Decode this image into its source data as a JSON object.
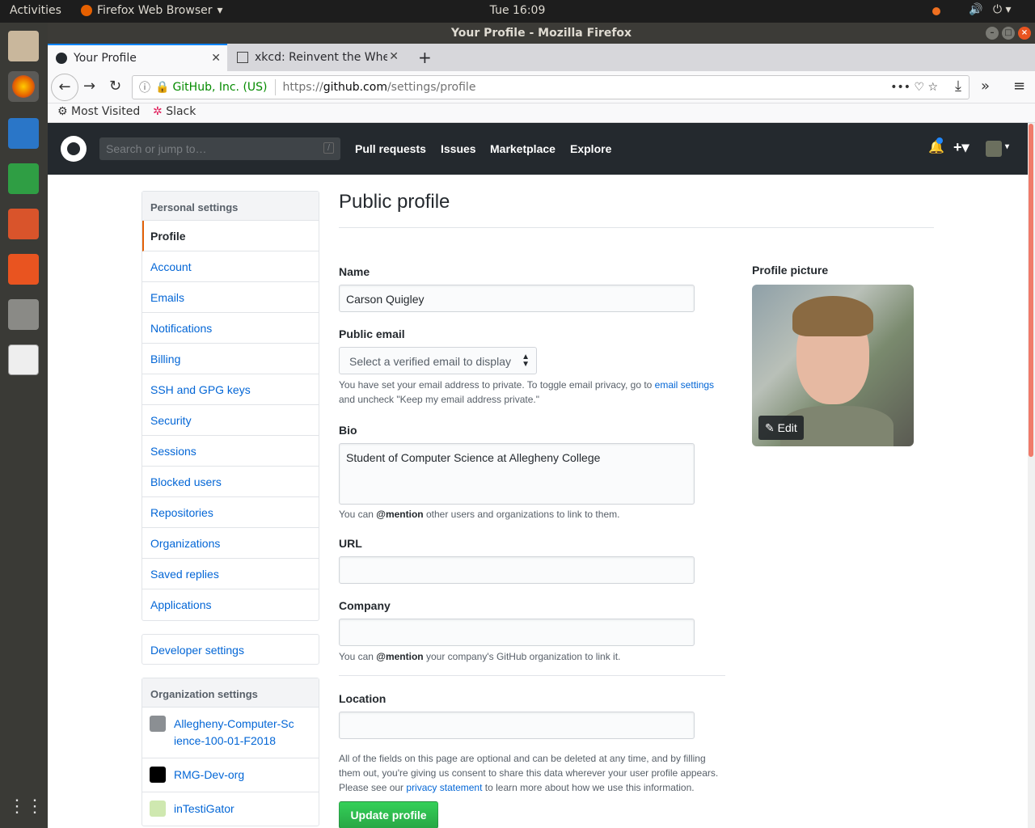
{
  "topbar": {
    "activities": "Activities",
    "app": "Firefox Web Browser",
    "clock": "Tue 16:09"
  },
  "window": {
    "title": "Your Profile - Mozilla Firefox"
  },
  "tabs": [
    {
      "label": "Your Profile"
    },
    {
      "label": "xkcd: Reinvent the Whee"
    }
  ],
  "navbar": {
    "identity": "GitHub, Inc. (US)",
    "url_prefix": "https://",
    "url_host": "github.com",
    "url_path": "/settings/profile"
  },
  "bookmarks": [
    {
      "label": "Most Visited"
    },
    {
      "label": "Slack"
    }
  ],
  "github": {
    "search_placeholder": "Search or jump to…",
    "search_key": "/",
    "nav": [
      "Pull requests",
      "Issues",
      "Marketplace",
      "Explore"
    ]
  },
  "sidebar": {
    "header": "Personal settings",
    "items": [
      "Profile",
      "Account",
      "Emails",
      "Notifications",
      "Billing",
      "SSH and GPG keys",
      "Security",
      "Sessions",
      "Blocked users",
      "Repositories",
      "Organizations",
      "Saved replies",
      "Applications"
    ],
    "developer": "Developer settings",
    "org_header": "Organization settings",
    "orgs": [
      "Allegheny-Computer-Science-100-01-F2018",
      "RMG-Dev-org",
      "inTestiGator"
    ]
  },
  "profile": {
    "title": "Public profile",
    "name_label": "Name",
    "name_value": "Carson Quigley",
    "email_label": "Public email",
    "email_select": "Select a verified email to display",
    "email_note_1": "You have set your email address to private. To toggle email privacy, go to ",
    "email_note_link": "email settings",
    "email_note_2": "and uncheck \"Keep my email address private.\"",
    "bio_label": "Bio",
    "bio_value": "Student of Computer Science at Allegheny College",
    "bio_note_1": "You can ",
    "bio_note_mention": "@mention",
    "bio_note_2": " other users and organizations to link to them.",
    "url_label": "URL",
    "company_label": "Company",
    "company_note_1": "You can ",
    "company_note_mention": "@mention",
    "company_note_2": " your company's GitHub organization to link it.",
    "location_label": "Location",
    "footer_1": "All of the fields on this page are optional and can be deleted at any time, and by filling them out, you're giving us consent to share this data wherever your user profile appears. Please see our ",
    "footer_link": "privacy statement",
    "footer_2": " to learn more about how we use this information.",
    "update_button": "Update profile",
    "picture_label": "Profile picture",
    "edit_label": "Edit"
  }
}
